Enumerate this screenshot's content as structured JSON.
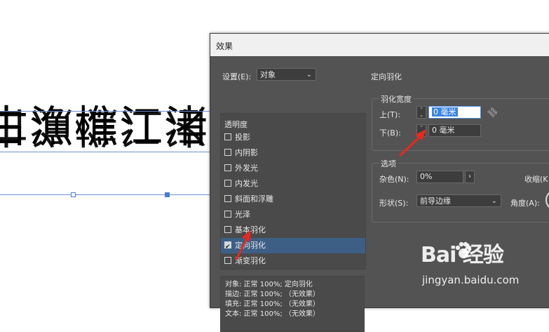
{
  "canvas": {
    "text_line": "古漁樵江渚上",
    "reflection_line": "古漁樵江渚上"
  },
  "dialog": {
    "title": "效果",
    "settings_label": "设置(E):",
    "settings_value": "对象",
    "section_title": "定向羽化",
    "list_header": "透明度",
    "effects": [
      {
        "label": "投影",
        "checked": false
      },
      {
        "label": "内阴影",
        "checked": false
      },
      {
        "label": "外发光",
        "checked": false
      },
      {
        "label": "内发光",
        "checked": false
      },
      {
        "label": "斜面和浮雕",
        "checked": false
      },
      {
        "label": "光泽",
        "checked": false
      },
      {
        "label": "基本羽化",
        "checked": false
      },
      {
        "label": "定向羽化",
        "checked": true
      },
      {
        "label": "渐变羽化",
        "checked": false
      }
    ],
    "summary": [
      "对象: 正常 100%; 定向羽化",
      "描边: 正常 100%; （无效果）",
      "填充: 正常 100%; （无效果）",
      "文本: 正常 100%; （无效果）"
    ],
    "feather_width": {
      "title": "羽化宽度",
      "top_label": "上(T):",
      "top_value": "0 毫米",
      "bottom_label": "下(B):",
      "bottom_value": "0 毫米"
    },
    "options": {
      "title": "选项",
      "noise_label": "杂色(N):",
      "noise_value": "0%",
      "shrink_label": "收缩(K",
      "shape_label": "形状(S):",
      "shape_value": "前导边缘",
      "angle_label": "角度(A):"
    }
  },
  "watermark": {
    "brand": "Bai  经验",
    "url": "jingyan.baidu.com"
  },
  "colors": {
    "dialog_bg": "#535353",
    "selection": "#3d5f86",
    "arrow": "#e8281e",
    "frame": "#6b8fd6"
  }
}
